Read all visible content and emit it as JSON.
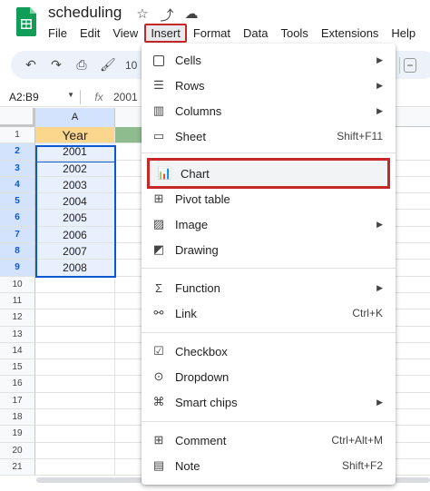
{
  "app": {
    "doc_title": "scheduling",
    "icons": [
      "star-icon",
      "move-to-folder-icon",
      "cloud-status-icon"
    ]
  },
  "menubar": [
    "File",
    "Edit",
    "View",
    "Insert",
    "Format",
    "Data",
    "Tools",
    "Extensions",
    "Help"
  ],
  "toolbar": {
    "zoom": "10"
  },
  "formula": {
    "name_box": "A2:B9",
    "fx": "fx",
    "value": "2001"
  },
  "sheet": {
    "col_a": "A",
    "row_numbers": [
      "1",
      "2",
      "3",
      "4",
      "5",
      "6",
      "7",
      "8",
      "9",
      "10",
      "11",
      "12",
      "13",
      "14",
      "15",
      "16",
      "17",
      "18",
      "19",
      "20",
      "21"
    ],
    "col_a_values": [
      "Year",
      "2001",
      "2002",
      "2003",
      "2004",
      "2005",
      "2006",
      "2007",
      "2008"
    ]
  },
  "insert_menu": {
    "cells": "Cells",
    "rows": "Rows",
    "columns": "Columns",
    "sheet": "Sheet",
    "sheet_shortcut": "Shift+F11",
    "chart": "Chart",
    "pivot_table": "Pivot table",
    "image": "Image",
    "drawing": "Drawing",
    "function": "Function",
    "link": "Link",
    "link_shortcut": "Ctrl+K",
    "checkbox": "Checkbox",
    "dropdown": "Dropdown",
    "smart_chips": "Smart chips",
    "comment": "Comment",
    "comment_shortcut": "Ctrl+Alt+M",
    "note": "Note",
    "note_shortcut": "Shift+F2"
  },
  "colors": {
    "highlight_border": "#c62828",
    "selection": "#0b57d0",
    "header_fill": "#fbd78d"
  }
}
